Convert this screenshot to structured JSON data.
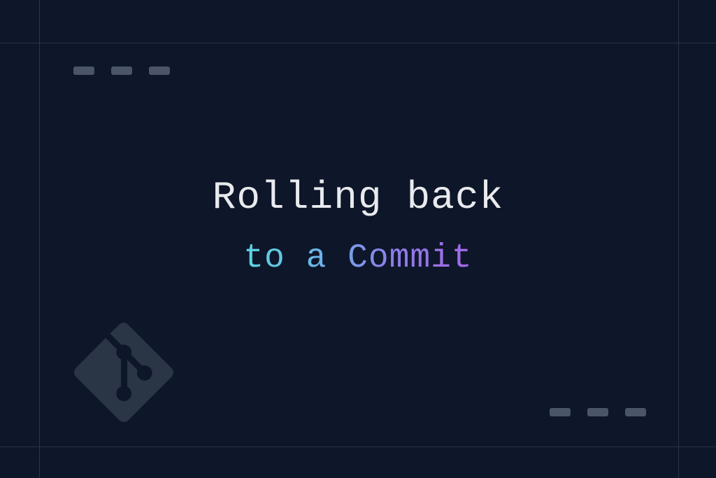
{
  "title": {
    "line1": "Rolling back",
    "line2": "to a Commit"
  },
  "icons": {
    "git": "git-icon"
  },
  "colors": {
    "background": "#0e1629",
    "gridLine": "#2a3547",
    "dash": "#4a5568",
    "textPrimary": "#e8eaed",
    "gradientStart": "#5ad6e0",
    "gradientEnd": "#a468e8"
  }
}
